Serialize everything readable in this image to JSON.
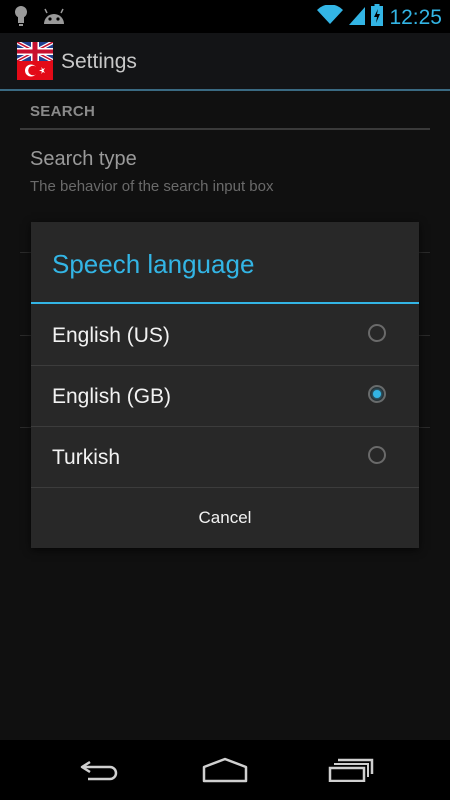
{
  "status_bar": {
    "time": "12:25",
    "icons": [
      "lightbulb-icon",
      "android-icon",
      "wifi-icon",
      "signal-icon",
      "battery-charging-icon"
    ]
  },
  "action_bar": {
    "title": "Settings",
    "app_icon": "uk-turkey-flag-icon"
  },
  "settings": {
    "category": "SEARCH",
    "items": [
      {
        "title": "Search type",
        "summary": "The behavior of the search input box"
      }
    ]
  },
  "dialog": {
    "title": "Speech language",
    "options": [
      {
        "label": "English (US)",
        "selected": false
      },
      {
        "label": "English (GB)",
        "selected": true
      },
      {
        "label": "Turkish",
        "selected": false
      }
    ],
    "cancel_label": "Cancel"
  },
  "nav_bar": {
    "buttons": [
      "back-icon",
      "home-icon",
      "recent-apps-icon"
    ]
  },
  "colors": {
    "accent": "#33b5e5",
    "dialog_bg": "#282828",
    "actionbar_bg": "#131416"
  }
}
